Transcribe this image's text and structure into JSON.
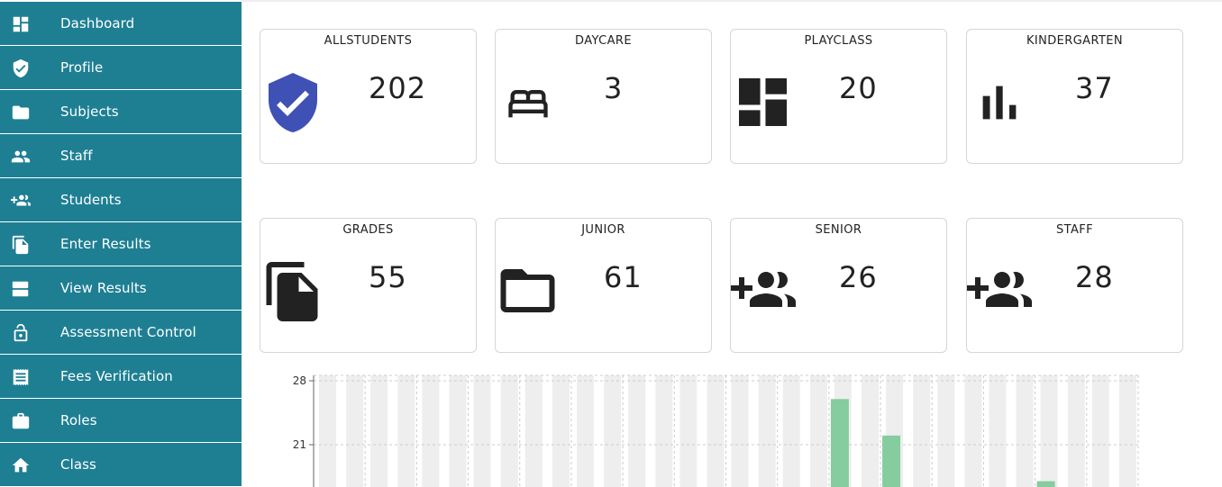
{
  "sidebar": {
    "items": [
      {
        "label": "Dashboard",
        "icon": "dashboard-icon"
      },
      {
        "label": "Profile",
        "icon": "verified-user-icon"
      },
      {
        "label": "Subjects",
        "icon": "folder-icon"
      },
      {
        "label": "Staff",
        "icon": "people-icon"
      },
      {
        "label": "Students",
        "icon": "group-add-icon"
      },
      {
        "label": "Enter Results",
        "icon": "file-copy-icon"
      },
      {
        "label": "View Results",
        "icon": "view-agenda-icon"
      },
      {
        "label": "Assessment Control",
        "icon": "lock-open-icon"
      },
      {
        "label": "Fees Verification",
        "icon": "receipt-icon"
      },
      {
        "label": "Roles",
        "icon": "work-icon"
      },
      {
        "label": "Class",
        "icon": "home-icon"
      }
    ]
  },
  "cards": [
    {
      "title": "ALLSTUDENTS",
      "value": "202",
      "icon": "verified-user-icon"
    },
    {
      "title": "DAYCARE",
      "value": "3",
      "icon": "bed-icon"
    },
    {
      "title": "PLAYCLASS",
      "value": "20",
      "icon": "dashboard-icon"
    },
    {
      "title": "KINDERGARTEN",
      "value": "37",
      "icon": "bar-chart-icon"
    },
    {
      "title": "GRADES",
      "value": "55",
      "icon": "file-copy-icon"
    },
    {
      "title": "JUNIOR",
      "value": "61",
      "icon": "folder-open-icon"
    },
    {
      "title": "SENIOR",
      "value": "26",
      "icon": "group-add-icon"
    },
    {
      "title": "STAFF",
      "value": "28",
      "icon": "group-add-icon"
    }
  ],
  "colors": {
    "sidebar_bg": "#1e7f93",
    "sidebar_text": "#ffffff",
    "shield_icon": "#3f51b5",
    "card_icon": "#222222",
    "bar_green": "#85cc9e",
    "bar_bg": "#eeeeee"
  },
  "chart_data": {
    "type": "bar",
    "yticks": [
      "28",
      "21"
    ],
    "ylim_visible": [
      21,
      28
    ],
    "category_count": 16,
    "values": [
      null,
      null,
      null,
      null,
      null,
      null,
      null,
      null,
      null,
      null,
      26,
      22,
      null,
      null,
      17,
      null
    ]
  }
}
